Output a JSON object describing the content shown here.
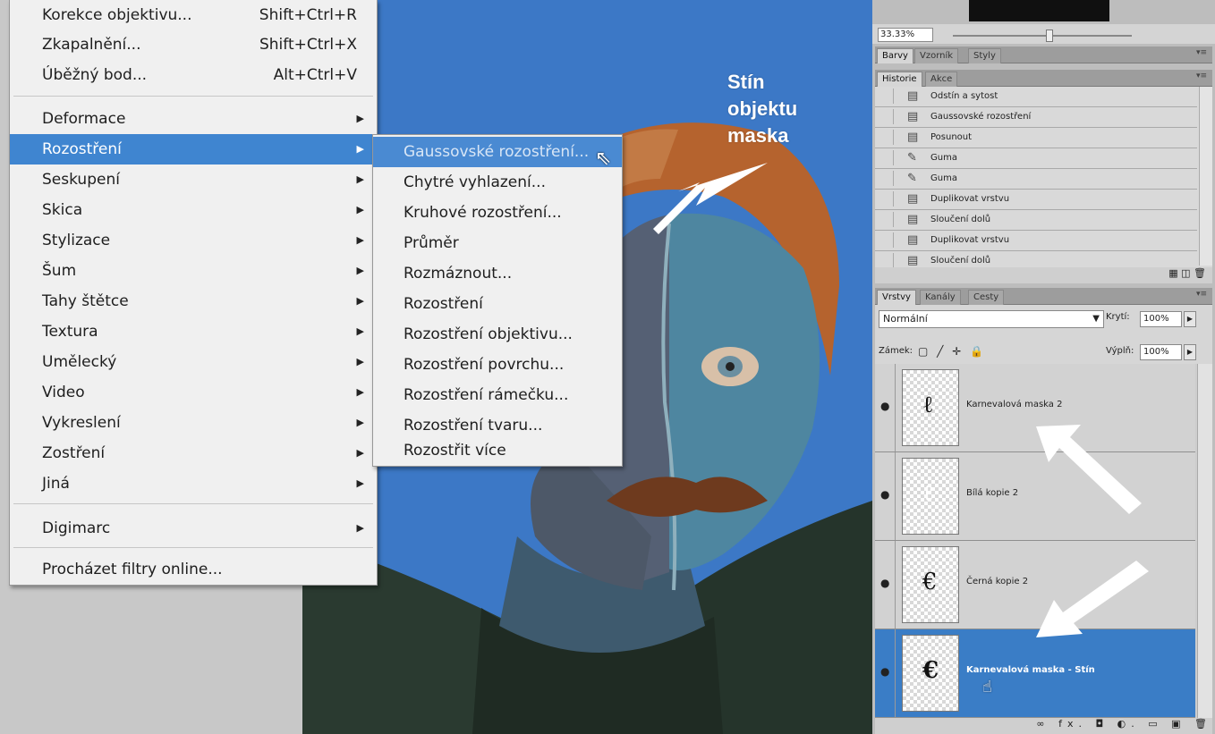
{
  "main_menu": {
    "group1": [
      {
        "label": "Korekce objektivu...",
        "shortcut": "Shift+Ctrl+R"
      },
      {
        "label": "Zkapalnění...",
        "shortcut": "Shift+Ctrl+X"
      },
      {
        "label": "Úběžný bod...",
        "shortcut": "Alt+Ctrl+V"
      }
    ],
    "group2": [
      {
        "label": "Deformace"
      },
      {
        "label": "Rozostření"
      },
      {
        "label": "Seskupení"
      },
      {
        "label": "Skica"
      },
      {
        "label": "Stylizace"
      },
      {
        "label": "Šum"
      },
      {
        "label": "Tahy štětce"
      },
      {
        "label": "Textura"
      },
      {
        "label": "Umělecký"
      },
      {
        "label": "Video"
      },
      {
        "label": "Vykreslení"
      },
      {
        "label": "Zostření"
      },
      {
        "label": "Jiná"
      }
    ],
    "digimarc": "Digimarc",
    "browse": "Procházet filtry online...",
    "submenu_arrow": "▶"
  },
  "submenu": {
    "items": [
      "Gaussovské rozostření...",
      "Chytré vyhlazení...",
      "Kruhové rozostření...",
      "Průměr",
      "Rozmáznout...",
      "Rozostření",
      "Rozostření objektivu...",
      "Rozostření povrchu...",
      "Rozostření rámečku...",
      "Rozostření tvaru...",
      "Rozostřit více"
    ]
  },
  "annotation": {
    "line1": "Stín",
    "line2": "objektu",
    "line3": "maska"
  },
  "navigator": {
    "zoom": "33.33%"
  },
  "color_tabs": [
    "Barvy",
    "Vzorník",
    "Styly"
  ],
  "history_tabs": [
    "Historie",
    "Akce"
  ],
  "history": [
    "Odstín a sytost",
    "Gaussovské rozostření",
    "Posunout",
    "Guma",
    "Guma",
    "Duplikovat vrstvu",
    "Sloučení dolů",
    "Duplikovat vrstvu",
    "Sloučení dolů"
  ],
  "layer_tabs": [
    "Vrstvy",
    "Kanály",
    "Cesty"
  ],
  "layers_panel": {
    "blend_mode": "Normální",
    "opacity_label": "Krytí:",
    "opacity": "100%",
    "lock_label": "Zámek:",
    "fill_label": "Výplň:",
    "fill": "100%"
  },
  "layers": [
    {
      "name": "Karnevalová maska 2",
      "selected": false
    },
    {
      "name": "Bílá kopie 2",
      "selected": false
    },
    {
      "name": "Černá kopie 2",
      "selected": false
    },
    {
      "name": "Karnevalová maska - Stín",
      "selected": true
    }
  ],
  "layers_footer": "∞ fx. ◘ ◐. ▭ ▣ 🗑",
  "colors": {
    "highlight": "#3f85d0",
    "photo_bg": "#3c78c6",
    "menu_bg": "#f0f0f0"
  }
}
